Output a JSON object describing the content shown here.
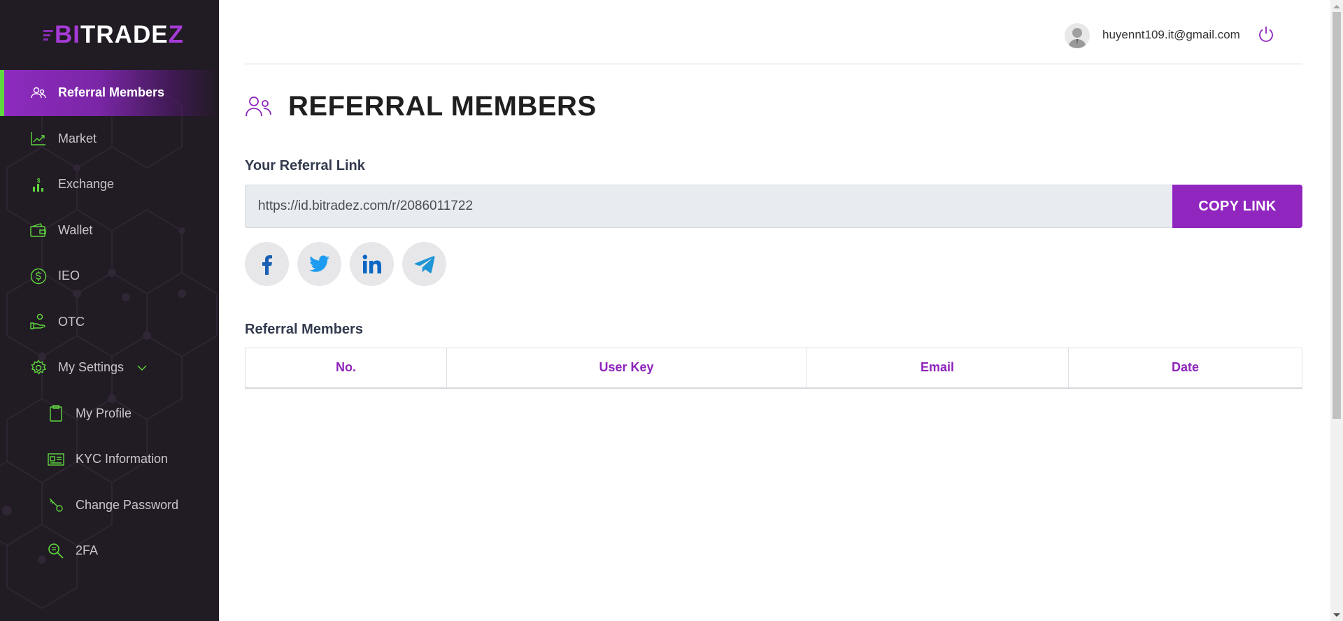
{
  "brand": {
    "logo_b": "B",
    "logo_i": "I",
    "logo_mid": "TRADE",
    "logo_z": "Z"
  },
  "sidebar": {
    "items": [
      {
        "label": "Referral Members",
        "icon": "users-icon",
        "active": true
      },
      {
        "label": "Market",
        "icon": "chart-trend-icon"
      },
      {
        "label": "Exchange",
        "icon": "exchange-bars-icon"
      },
      {
        "label": "Wallet",
        "icon": "wallet-icon"
      },
      {
        "label": "IEO",
        "icon": "dollar-circle-icon"
      },
      {
        "label": "OTC",
        "icon": "hand-coin-icon"
      },
      {
        "label": "My Settings",
        "icon": "gear-icon",
        "expanded": true
      },
      {
        "label": "My Profile",
        "icon": "clipboard-icon"
      },
      {
        "label": "KYC Information",
        "icon": "id-card-icon"
      },
      {
        "label": "Change Password",
        "icon": "key-icon"
      },
      {
        "label": "2FA",
        "icon": "search-shield-icon"
      }
    ]
  },
  "header": {
    "user_email": "huyennt109.it@gmail.com"
  },
  "main": {
    "title": "REFERRAL MEMBERS",
    "referral_link_label": "Your Referral Link",
    "referral_link_value": "https://id.bitradez.com/r/2086011722",
    "copy_button": "COPY LINK",
    "social": [
      "facebook-icon",
      "twitter-icon",
      "linkedin-icon",
      "telegram-icon"
    ],
    "members_label": "Referral Members",
    "table": {
      "columns": [
        "No.",
        "User Key",
        "Email",
        "Date"
      ],
      "rows": []
    }
  },
  "colors": {
    "accent": "#9126bf",
    "sidebar_bg": "#211b23",
    "icon_green": "#5fd83f"
  }
}
